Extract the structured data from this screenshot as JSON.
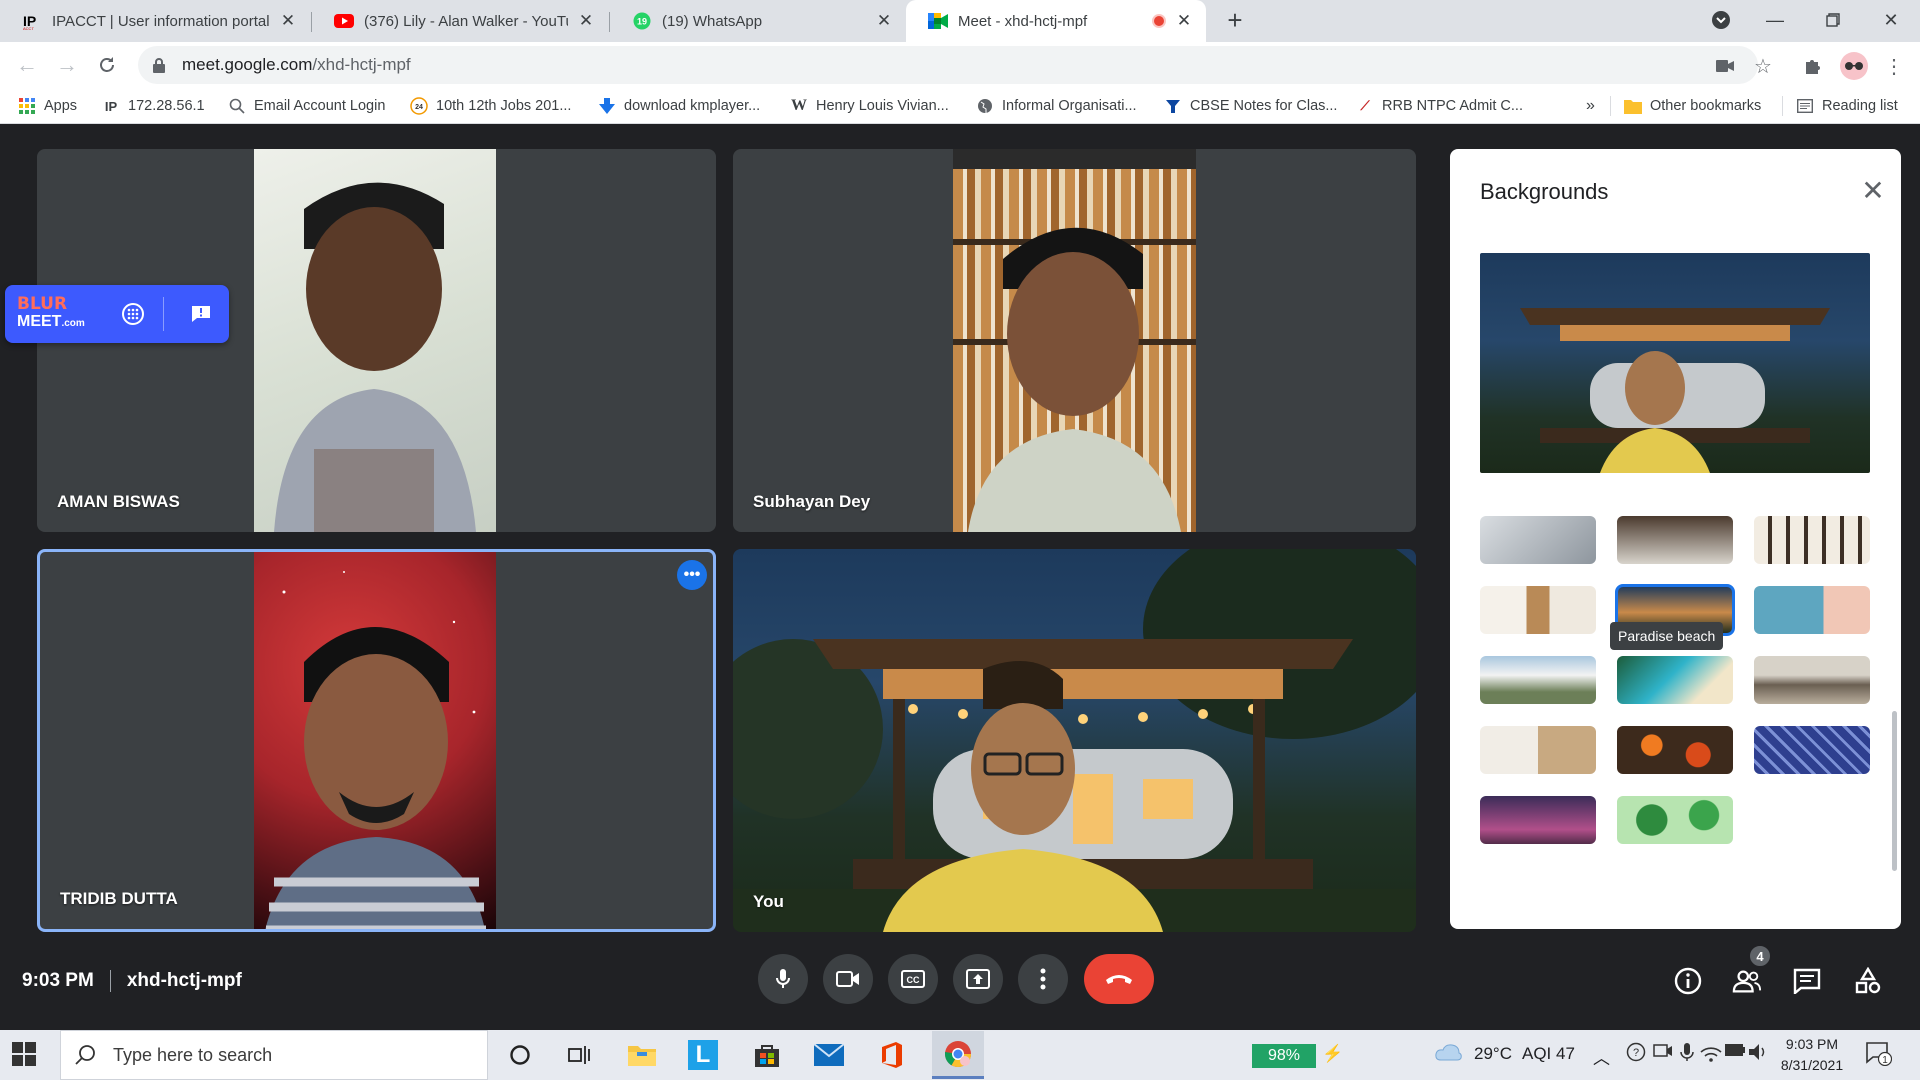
{
  "browser": {
    "tabs": [
      {
        "title": "IPACCT | User information portal",
        "favicon": "ipacct-icon",
        "active": false
      },
      {
        "title": "(376) Lily - Alan Walker - YouTube",
        "favicon": "youtube-icon",
        "active": false
      },
      {
        "title": "(19) WhatsApp",
        "favicon": "whatsapp-icon",
        "active": false
      },
      {
        "title": "Meet - xhd-hctj-mpf",
        "favicon": "meet-icon",
        "active": true
      }
    ],
    "url_host": "meet.google.com",
    "url_path": "/xhd-hctj-mpf",
    "bookmarks": [
      {
        "label": "Apps",
        "icon": "apps-grid-icon"
      },
      {
        "label": "172.28.56.1",
        "icon": "ipacct-icon"
      },
      {
        "label": "Email Account Login",
        "icon": "search-icon"
      },
      {
        "label": "10th 12th Jobs 201...",
        "icon": "jobs-icon"
      },
      {
        "label": "download kmplayer...",
        "icon": "download-icon"
      },
      {
        "label": "Henry Louis Vivian...",
        "icon": "wikipedia-icon"
      },
      {
        "label": "Informal Organisati...",
        "icon": "globe-icon"
      },
      {
        "label": "CBSE Notes for Clas...",
        "icon": "cbse-icon"
      },
      {
        "label": "RRB NTPC Admit C...",
        "icon": "rrb-icon"
      }
    ],
    "overflow_label": "»",
    "other_bookmarks": "Other bookmarks",
    "reading_list": "Reading list"
  },
  "meet": {
    "participants": [
      {
        "name": "AMAN BISWAS"
      },
      {
        "name": "Subhayan Dey"
      },
      {
        "name": "TRIDIB DUTTA"
      },
      {
        "name": "You"
      }
    ],
    "extension": {
      "brand_top": "BLUR",
      "brand_bottom": "MEET",
      "brand_suffix": ".com"
    },
    "more_options_glyph": "•••",
    "backgrounds_panel": {
      "title": "Backgrounds",
      "tooltip": "Paradise beach",
      "selected_index": 4
    },
    "time": "9:03 PM",
    "meeting_code": "xhd-hctj-mpf",
    "participant_count": "4"
  },
  "taskbar": {
    "search_placeholder": "Type here to search",
    "battery": "98%",
    "weather": "29°C",
    "aqi": "AQI 47",
    "time": "9:03 PM",
    "date": "8/31/2021",
    "notifications": "1"
  },
  "colors": {
    "meet_bg": "#202124",
    "tile_bg": "#3c4043",
    "hangup": "#ea4335",
    "accent": "#1a73e8",
    "extension": "#3d5afe"
  }
}
